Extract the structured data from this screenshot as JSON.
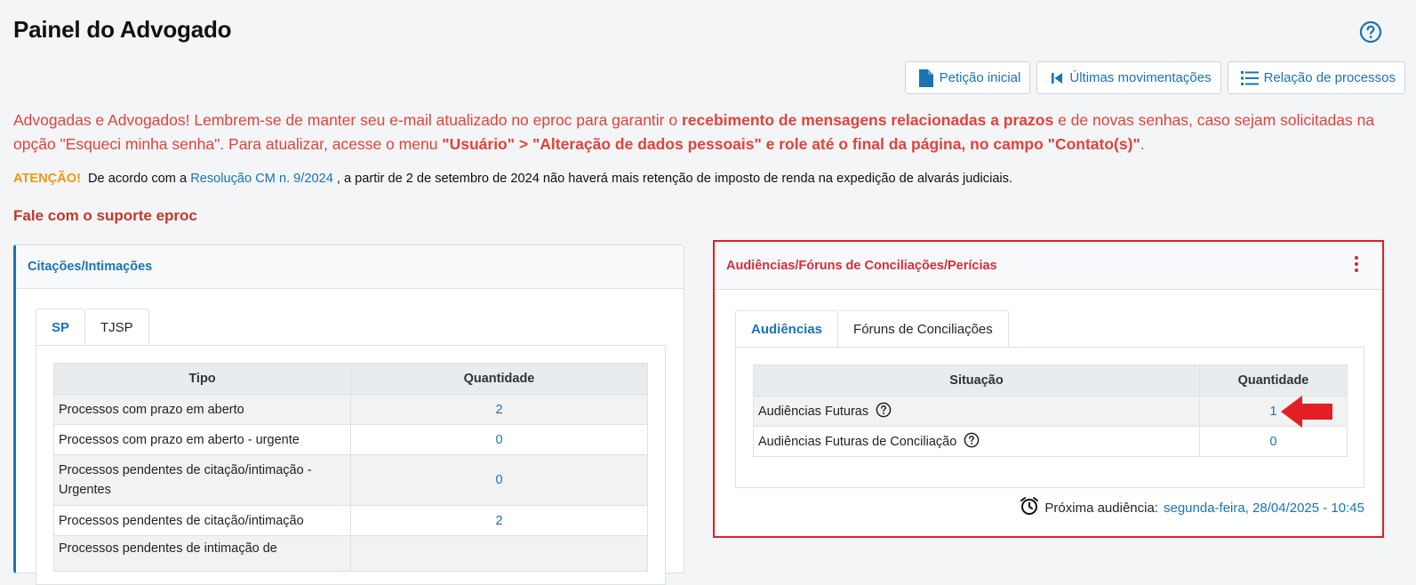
{
  "header": {
    "title": "Painel do Advogado",
    "help_icon": "question-circle-icon"
  },
  "actions": [
    {
      "label": "Petição inicial",
      "icon": "file-icon"
    },
    {
      "label": "Últimas movimentações",
      "icon": "skip-back-icon"
    },
    {
      "label": "Relação de processos",
      "icon": "list-icon"
    }
  ],
  "notice": {
    "part1": "Advogadas e Advogados! Lembrem-se de manter seu e-mail atualizado no eproc para garantir o ",
    "bold1": "recebimento de mensagens relacionadas a prazos",
    "part2": " e de novas senhas, caso sejam solicitadas na opção \"Esqueci minha senha\". Para atualizar, acesse o menu ",
    "bold2": "\"Usuário\" > \"Alteração de dados pessoais\" e role até o final da página, no campo \"Contato(s)\"",
    "part3": "."
  },
  "attention": {
    "label": "ATENÇÃO!",
    "text_before": "De acordo com a ",
    "link": "Resolução CM n. 9/2024",
    "text_after": " , a partir de 2 de setembro de 2024 não haverá mais retenção de imposto de renda na expedição de alvarás judiciais."
  },
  "support_link": "Fale com o suporte eproc",
  "citacoes": {
    "title": "Citações/Intimações",
    "tabs": [
      "SP",
      "TJSP"
    ],
    "columns": [
      "Tipo",
      "Quantidade"
    ],
    "rows": [
      {
        "tipo": "Processos com prazo em aberto",
        "quantidade": "2"
      },
      {
        "tipo": "Processos com prazo em aberto - urgente",
        "quantidade": "0"
      },
      {
        "tipo": "Processos pendentes de citação/intimação - Urgentes",
        "quantidade": "0"
      },
      {
        "tipo": "Processos pendentes de citação/intimação",
        "quantidade": "2"
      },
      {
        "tipo": "Processos pendentes de intimação de",
        "quantidade": ""
      }
    ]
  },
  "audiencias": {
    "title": "Audiências/Fóruns de Conciliações/Perícias",
    "menu_icon": "kebab-menu-icon",
    "tabs": [
      "Audiências",
      "Fóruns de Conciliações"
    ],
    "columns": [
      "Situação",
      "Quantidade"
    ],
    "rows": [
      {
        "situacao": "Audiências Futuras",
        "quantidade": "1"
      },
      {
        "situacao": "Audiências Futuras de Conciliação",
        "quantidade": "0"
      }
    ],
    "next_label": "Próxima audiência:",
    "next_value": "segunda-feira, 28/04/2025 - 10:45",
    "next_icon": "alarm-clock-icon"
  },
  "colors": {
    "accent": "#1a73b5",
    "warning": "#e0433c",
    "highlight_border": "#e31e24",
    "attention": "#f0961b"
  }
}
